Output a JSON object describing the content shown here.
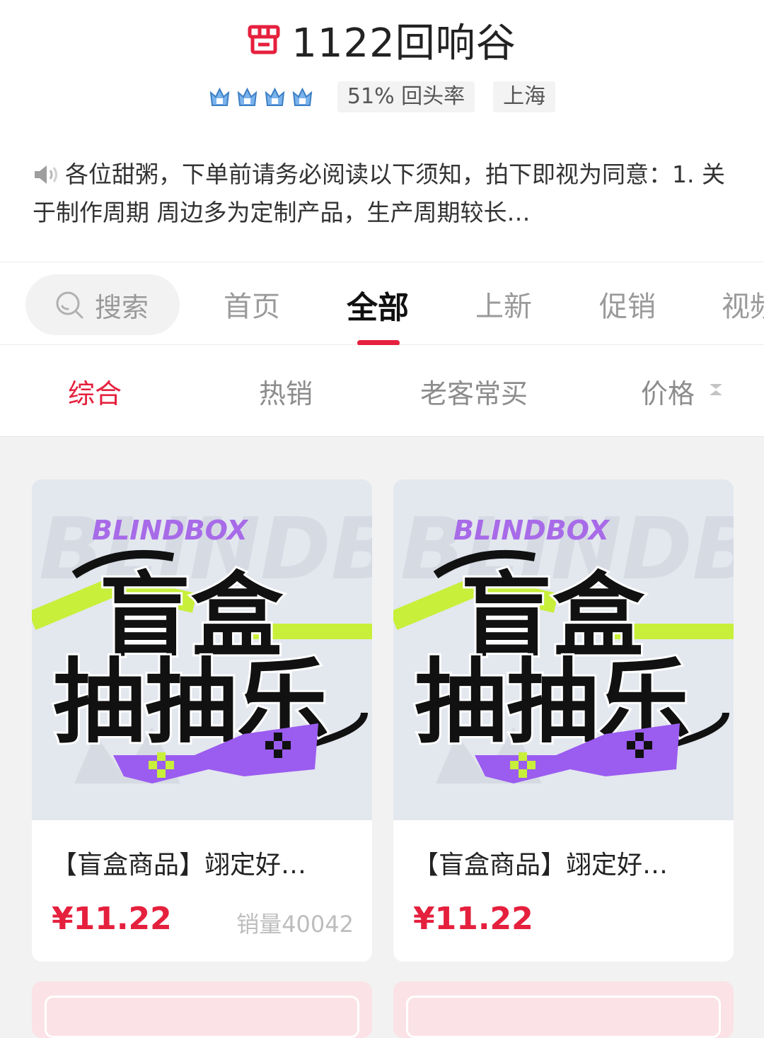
{
  "shop": {
    "name": "1122回响谷",
    "level_icons": [
      "crown-icon",
      "crown-icon",
      "crown-icon",
      "crown-icon"
    ],
    "repeat_rate": "51% 回头率",
    "location": "上海"
  },
  "notice": {
    "text": "各位甜粥，下单前请务必阅读以下须知，拍下即视为同意：1. 关于制作周期  周边多为定制产品，生产周期较长…"
  },
  "nav": {
    "search_label": "搜索",
    "tabs": [
      {
        "label": "首页"
      },
      {
        "label": "全部"
      },
      {
        "label": "上新"
      },
      {
        "label": "促销"
      },
      {
        "label": "视频"
      }
    ]
  },
  "filters": [
    {
      "label": "综合"
    },
    {
      "label": "热销"
    },
    {
      "label": "老客常买"
    },
    {
      "label": "价格"
    }
  ],
  "products": [
    {
      "image_text_top": "BLINDBOX",
      "image_text_1": "盲盒",
      "image_text_2": "抽抽乐",
      "title": "【盲盒商品】翊定好…",
      "price": "¥11.22",
      "sales": "销量40042"
    },
    {
      "image_text_top": "BLINDBOX",
      "image_text_1": "盲盒",
      "image_text_2": "抽抽乐",
      "title": "【盲盒商品】翊定好…",
      "price": "¥11.22",
      "sales": ""
    }
  ],
  "colors": {
    "accent": "#e5203d",
    "image_bg": "#e3e7ee",
    "lime": "#c8ef3a",
    "purple": "#9b5cf0"
  }
}
